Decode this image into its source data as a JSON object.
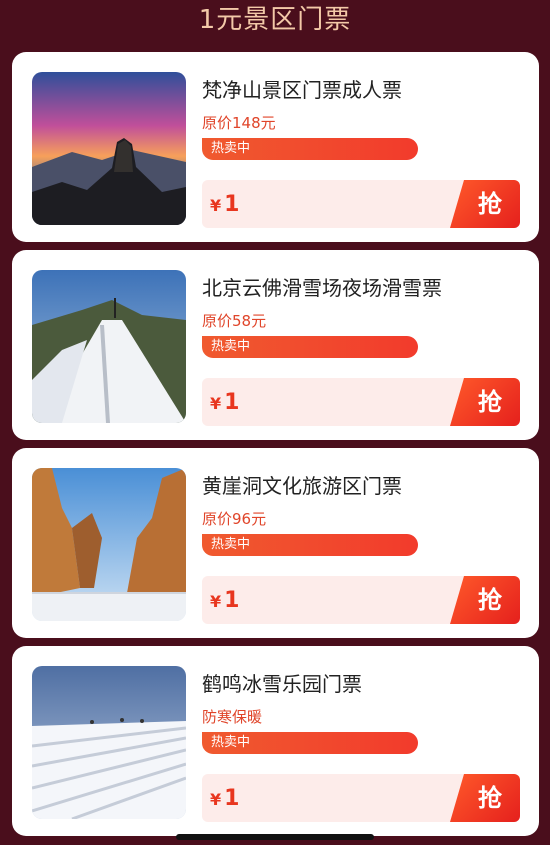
{
  "page": {
    "title": "1元景区门票"
  },
  "items": [
    {
      "title": "梵净山景区门票成人票",
      "subtitle": "原价148元",
      "tag": "热卖中",
      "price_symbol": "¥",
      "price": "1",
      "button": "抢"
    },
    {
      "title": "北京云佛滑雪场夜场滑雪票",
      "subtitle": "原价58元",
      "tag": "热卖中",
      "price_symbol": "¥",
      "price": "1",
      "button": "抢"
    },
    {
      "title": "黄崖洞文化旅游区门票",
      "subtitle": "原价96元",
      "tag": "热卖中",
      "price_symbol": "¥",
      "price": "1",
      "button": "抢"
    },
    {
      "title": "鹤鸣冰雪乐园门票",
      "subtitle": "防寒保暖",
      "tag": "热卖中",
      "price_symbol": "¥",
      "price": "1",
      "button": "抢"
    }
  ]
}
